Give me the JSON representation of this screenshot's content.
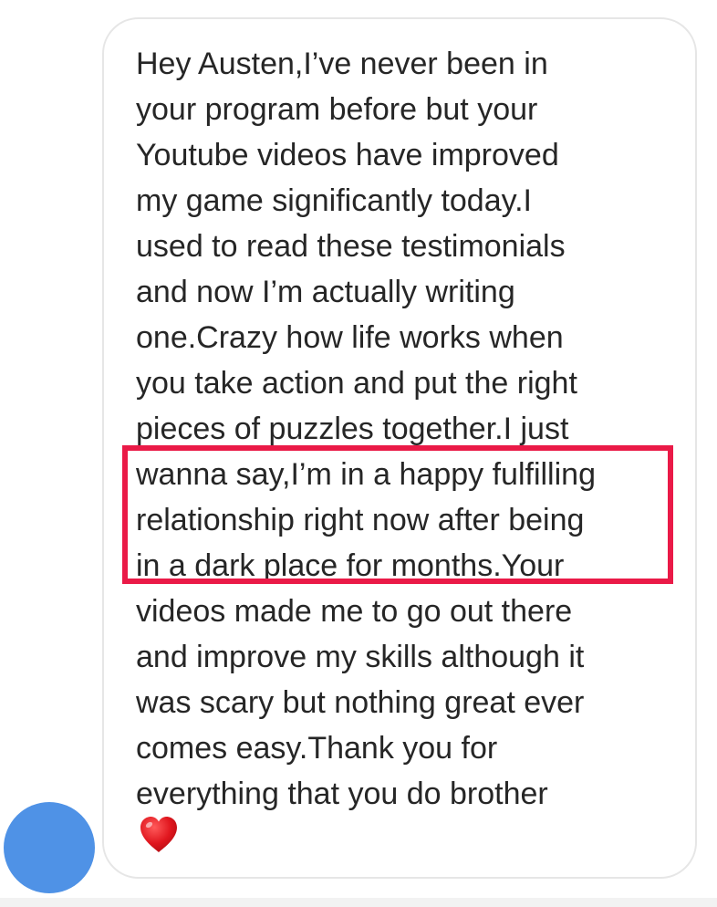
{
  "message": {
    "lines": [
      "Hey Austen,I’ve never been in",
      "your program before but your",
      "Youtube videos have improved",
      "my game significantly today.I",
      "used to read these testimonials",
      "and now I’m actually writing",
      "one.Crazy how life works when",
      "you take action and put the right",
      "pieces of puzzles together.I just",
      "wanna say,I’m in a happy fulfilling",
      "relationship right now after being",
      "in a dark place for months.Your",
      "videos made me to go out there",
      "and improve my skills although it",
      "was scary but nothing great ever",
      "comes easy.Thank you for",
      "everything that you do brother"
    ],
    "emoji": "heart-emoji-icon"
  },
  "colors": {
    "text": "#262626",
    "bubble_border": "#e6e6e6",
    "highlight": "#ea1a47",
    "avatar": "#4f92e6"
  }
}
